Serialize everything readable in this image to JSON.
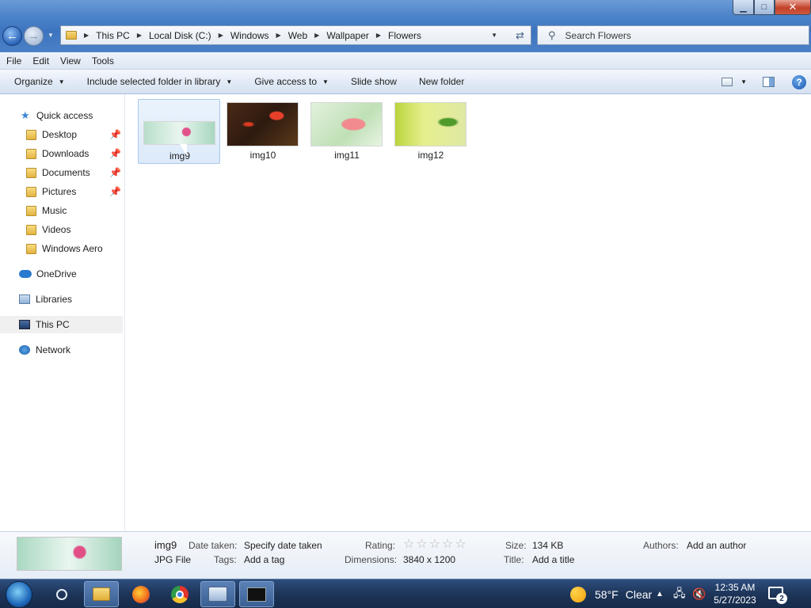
{
  "window": {
    "controls": {
      "minimize": "▁",
      "maximize": "□",
      "close": "✕"
    }
  },
  "navigation": {
    "back_icon": "arrow-left-icon",
    "forward_icon": "arrow-right-icon"
  },
  "address_bar": {
    "crumbs": [
      "This PC",
      "Local Disk (C:)",
      "Windows",
      "Web",
      "Wallpaper",
      "Flowers"
    ]
  },
  "search": {
    "placeholder": "Search Flowers"
  },
  "menu": {
    "items": [
      "File",
      "Edit",
      "View",
      "Tools"
    ]
  },
  "toolbar": {
    "organize": "Organize",
    "include_library": "Include selected folder in library",
    "give_access": "Give access to",
    "slide_show": "Slide show",
    "new_folder": "New folder",
    "help": "?"
  },
  "nav_pane": {
    "quick_access": "Quick access",
    "quick_items": [
      {
        "label": "Desktop",
        "pinned": true
      },
      {
        "label": "Downloads",
        "pinned": true
      },
      {
        "label": "Documents",
        "pinned": true
      },
      {
        "label": "Pictures",
        "pinned": true
      },
      {
        "label": "Music",
        "pinned": false
      },
      {
        "label": "Videos",
        "pinned": false
      },
      {
        "label": "Windows Aero",
        "pinned": false
      }
    ],
    "onedrive": "OneDrive",
    "libraries": "Libraries",
    "this_pc": "This PC",
    "network": "Network"
  },
  "files": [
    {
      "name": "img9",
      "selected": true
    },
    {
      "name": "img10",
      "selected": false
    },
    {
      "name": "img11",
      "selected": false
    },
    {
      "name": "img12",
      "selected": false
    }
  ],
  "details": {
    "name": "img9",
    "type": "JPG File",
    "date_taken_label": "Date taken:",
    "date_taken_value": "Specify date taken",
    "tags_label": "Tags:",
    "tags_value": "Add a tag",
    "rating_label": "Rating:",
    "rating_stars": "☆☆☆☆☆",
    "dimensions_label": "Dimensions:",
    "dimensions_value": "3840 x 1200",
    "size_label": "Size:",
    "size_value": "134 KB",
    "title_label": "Title:",
    "title_value": "Add a title",
    "authors_label": "Authors:",
    "authors_value": "Add an author"
  },
  "taskbar": {
    "weather_temp": "58°F",
    "weather_text": "Clear",
    "time": "12:35 AM",
    "date": "5/27/2023",
    "notification_count": "2"
  }
}
